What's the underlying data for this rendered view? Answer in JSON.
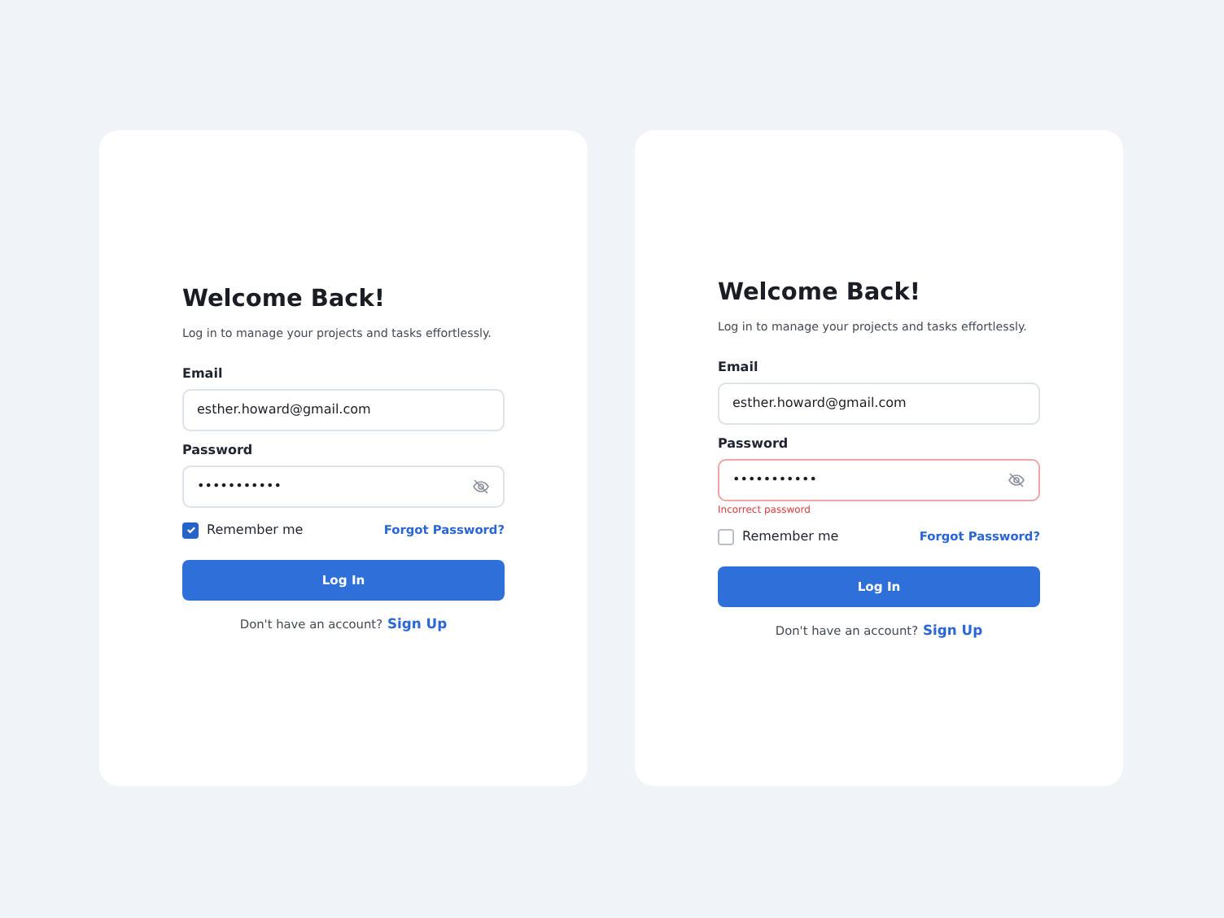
{
  "cards": [
    {
      "title": "Welcome Back!",
      "subtitle": "Log in to manage your projects and tasks effortlessly.",
      "email": {
        "label": "Email",
        "value": "esther.howard@gmail.com"
      },
      "password": {
        "label": "Password",
        "value": "•••••••••••"
      },
      "remember": {
        "label": "Remember me",
        "checked": true
      },
      "forgot": "Forgot Password?",
      "button": "Log In",
      "signup_prompt": "Don't have an account?",
      "signup_link": "Sign Up"
    },
    {
      "title": "Welcome Back!",
      "subtitle": "Log in to manage your projects and tasks effortlessly.",
      "email": {
        "label": "Email",
        "value": "esther.howard@gmail.com"
      },
      "password": {
        "label": "Password",
        "value": "•••••••••••",
        "error": "Incorrect password"
      },
      "remember": {
        "label": "Remember me",
        "checked": false
      },
      "forgot": "Forgot Password?",
      "button": "Log In",
      "signup_prompt": "Don't have an account?",
      "signup_link": "Sign Up"
    }
  ]
}
